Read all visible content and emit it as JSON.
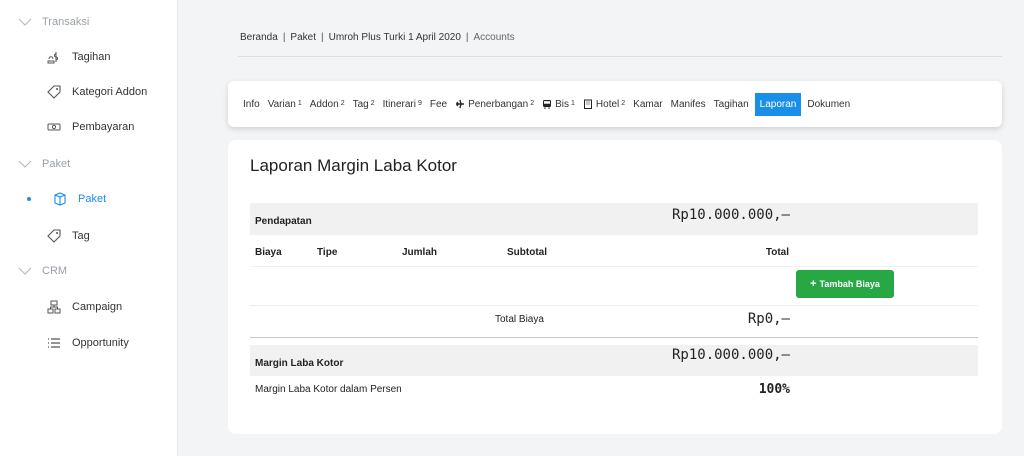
{
  "sidebar": {
    "items": [
      {
        "type": "section",
        "label": "Transaksi",
        "icon": "chevron-down-icon"
      },
      {
        "type": "link",
        "label": "Tagihan",
        "icon": "money-icon"
      },
      {
        "type": "link",
        "label": "Kategori Addon",
        "icon": "tag-icon"
      },
      {
        "type": "link",
        "label": "Pembayaran",
        "icon": "payment-icon"
      },
      {
        "type": "section",
        "label": "Paket",
        "icon": "chevron-down-icon"
      },
      {
        "type": "link",
        "label": "Paket",
        "icon": "package-icon",
        "active": true
      },
      {
        "type": "link",
        "label": "Tag",
        "icon": "tag-icon"
      },
      {
        "type": "section",
        "label": "CRM",
        "icon": "chevron-down-icon"
      },
      {
        "type": "link",
        "label": "Campaign",
        "icon": "sitemap-icon"
      },
      {
        "type": "link",
        "label": "Opportunity",
        "icon": "list-icon"
      }
    ]
  },
  "breadcrumb": {
    "items": [
      "Beranda",
      "Paket",
      "Umroh Plus Turki 1 April 2020",
      "Accounts"
    ]
  },
  "tabs": [
    {
      "label": "Info"
    },
    {
      "label": "Varian",
      "count": "1"
    },
    {
      "label": "Addon",
      "count": "2"
    },
    {
      "label": "Tag",
      "count": "2"
    },
    {
      "label": "Itinerari",
      "count": "9"
    },
    {
      "label": "Fee"
    },
    {
      "label": "Penerbangan",
      "count": "2",
      "icon": "plane-icon"
    },
    {
      "label": "Bis",
      "count": "1",
      "icon": "bus-icon"
    },
    {
      "label": "Hotel",
      "count": "2",
      "icon": "building-icon"
    },
    {
      "label": "Kamar"
    },
    {
      "label": "Manifes"
    },
    {
      "label": "Tagihan"
    },
    {
      "label": "Laporan",
      "active": true
    },
    {
      "label": "Dokumen"
    }
  ],
  "report": {
    "title": "Laporan Margin Laba Kotor",
    "pendapatan_label": "Pendapatan",
    "pendapatan_value": "Rp10.000.000,–",
    "columns": {
      "biaya": "Biaya",
      "tipe": "Tipe",
      "jumlah": "Jumlah",
      "subtotal": "Subtotal",
      "total": "Total"
    },
    "add_cost_button": "Tambah Biaya",
    "total_biaya_label": "Total Biaya",
    "total_biaya_value": "Rp0,–",
    "margin_label": "Margin Laba Kotor",
    "margin_value": "Rp10.000.000,–",
    "margin_percent_label": "Margin Laba Kotor dalam Persen",
    "margin_percent_value": "100%"
  },
  "colors": {
    "accent": "#1a8fe8",
    "success": "#28a745",
    "background": "#f3f4f6"
  }
}
